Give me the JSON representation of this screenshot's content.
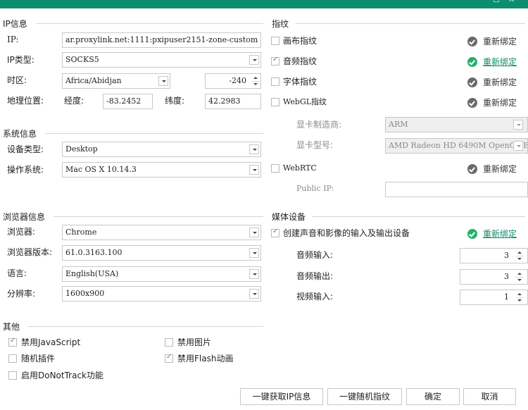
{
  "window": {
    "maximize_icon": "maximize-icon",
    "close_icon": "close-icon"
  },
  "ip_info": {
    "section_title": "IP信息",
    "ip_label": "IP:",
    "ip_value": "ar.proxylink.net:1111:pxipuser2151-zone-custom",
    "ip_type_label": "IP类型:",
    "ip_type_value": "SOCKS5",
    "timezone_label": "时区:",
    "timezone_value": "Africa/Abidjan",
    "timezone_offset": "-240",
    "geo_label": "地理位置:",
    "longitude_label": "经度:",
    "longitude_value": "-83.2452",
    "latitude_label": "纬度:",
    "latitude_value": "42.2983"
  },
  "system_info": {
    "section_title": "系统信息",
    "device_type_label": "设备类型:",
    "device_type_value": "Desktop",
    "os_label": "操作系统:",
    "os_value": "Mac OS X 10.14.3"
  },
  "browser_info": {
    "section_title": "浏览器信息",
    "browser_label": "浏览器:",
    "browser_value": "Chrome",
    "version_label": "浏览器版本:",
    "version_value": "61.0.3163.100",
    "language_label": "语言:",
    "language_value": "English(USA)",
    "resolution_label": "分辨率:",
    "resolution_value": "1600x900"
  },
  "other": {
    "section_title": "其他",
    "options": [
      {
        "label": "禁用JavaScript",
        "checked": true
      },
      {
        "label": "禁用图片",
        "checked": false
      },
      {
        "label": "随机插件",
        "checked": false
      },
      {
        "label": "禁用Flash动画",
        "checked": true
      },
      {
        "label": "启用DoNotTrack功能",
        "checked": false
      }
    ]
  },
  "fingerprint": {
    "section_title": "指纹",
    "rebind_label": "重新绑定",
    "items": [
      {
        "label": "画布指纹",
        "checked": false,
        "rebind_active": false
      },
      {
        "label": "音频指纹",
        "checked": true,
        "rebind_active": true
      },
      {
        "label": "字体指纹",
        "checked": false,
        "rebind_active": false
      },
      {
        "label": "WebGL指纹",
        "checked": false,
        "rebind_active": false
      }
    ],
    "gpu_vendor_label": "显卡制造商:",
    "gpu_vendor_value": "ARM",
    "gpu_model_label": "显卡型号:",
    "gpu_model_value": "AMD Radeon HD 6490M OpenGL E",
    "webrtc": {
      "label": "WebRTC",
      "checked": false,
      "rebind_active": false
    },
    "public_ip_label": "Public IP:",
    "public_ip_value": ""
  },
  "media": {
    "section_title": "媒体设备",
    "create_label": "创建声音和影像的输入及输出设备",
    "create_checked": true,
    "rebind_active": true,
    "audio_in_label": "音频输入:",
    "audio_in_value": "3",
    "audio_out_label": "音频输出:",
    "audio_out_value": "3",
    "video_in_label": "视频输入:",
    "video_in_value": "1"
  },
  "buttons": {
    "get_ip": "一键获取IP信息",
    "random_fp": "一键随机指纹",
    "ok": "确定",
    "cancel": "取消"
  },
  "colors": {
    "titlebar": "#0c8e6e",
    "accent_link": "#138c6c",
    "active_check": "#23b26a",
    "inactive_check": "#6a6a6a"
  }
}
